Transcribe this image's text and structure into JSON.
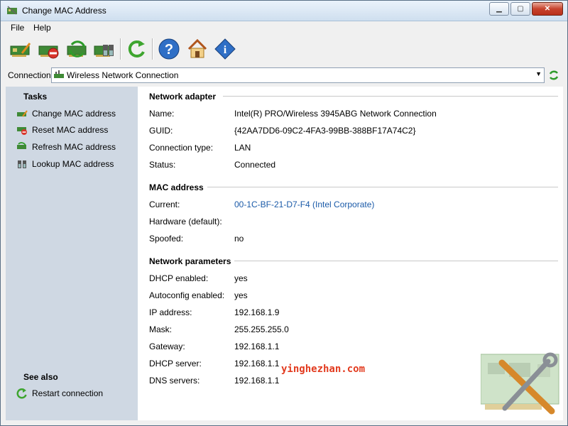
{
  "window": {
    "title": "Change MAC Address"
  },
  "menu": [
    "File",
    "Help"
  ],
  "toolbar": {
    "buttons": [
      "change-mac",
      "reset-mac",
      "refresh-mac",
      "lookup-mac",
      "restart-connection",
      "help",
      "home",
      "about"
    ]
  },
  "connection": {
    "label": "Connection:",
    "selected": "Wireless Network Connection"
  },
  "sidebar": {
    "tasks_heading": "Tasks",
    "tasks": [
      {
        "label": "Change MAC address",
        "icon": "change-mac-icon"
      },
      {
        "label": "Reset MAC address",
        "icon": "reset-mac-icon"
      },
      {
        "label": "Refresh MAC address",
        "icon": "refresh-mac-icon"
      },
      {
        "label": "Lookup MAC address",
        "icon": "lookup-mac-icon"
      }
    ],
    "seealso_heading": "See also",
    "seealso": [
      {
        "label": "Restart connection",
        "icon": "restart-icon"
      }
    ]
  },
  "adapter": {
    "heading": "Network adapter",
    "rows": [
      {
        "label": "Name:",
        "value": "Intel(R) PRO/Wireless 3945ABG Network Connection"
      },
      {
        "label": "GUID:",
        "value": "{42AA7DD6-09C2-4FA3-99BB-388BF17A74C2}"
      },
      {
        "label": "Connection type:",
        "value": "LAN"
      },
      {
        "label": "Status:",
        "value": "Connected"
      }
    ]
  },
  "mac": {
    "heading": "MAC address",
    "rows": [
      {
        "label": "Current:",
        "value": "00-1C-BF-21-D7-F4 (Intel Corporate)"
      },
      {
        "label": "Hardware (default):",
        "value": ""
      },
      {
        "label": "Spoofed:",
        "value": "no"
      }
    ]
  },
  "params": {
    "heading": "Network parameters",
    "rows": [
      {
        "label": "DHCP enabled:",
        "value": "yes"
      },
      {
        "label": "Autoconfig enabled:",
        "value": "yes"
      },
      {
        "label": "IP address:",
        "value": "192.168.1.9"
      },
      {
        "label": "Mask:",
        "value": "255.255.255.0"
      },
      {
        "label": "Gateway:",
        "value": "192.168.1.1"
      },
      {
        "label": "DHCP server:",
        "value": "192.168.1.1"
      },
      {
        "label": "DNS servers:",
        "value": "192.168.1.1"
      }
    ]
  },
  "watermark": "yinghezhan.com",
  "colors": {
    "link": "#1a5aa8",
    "sidebar": "#cfd8e3",
    "watermark": "#e23b1f"
  }
}
